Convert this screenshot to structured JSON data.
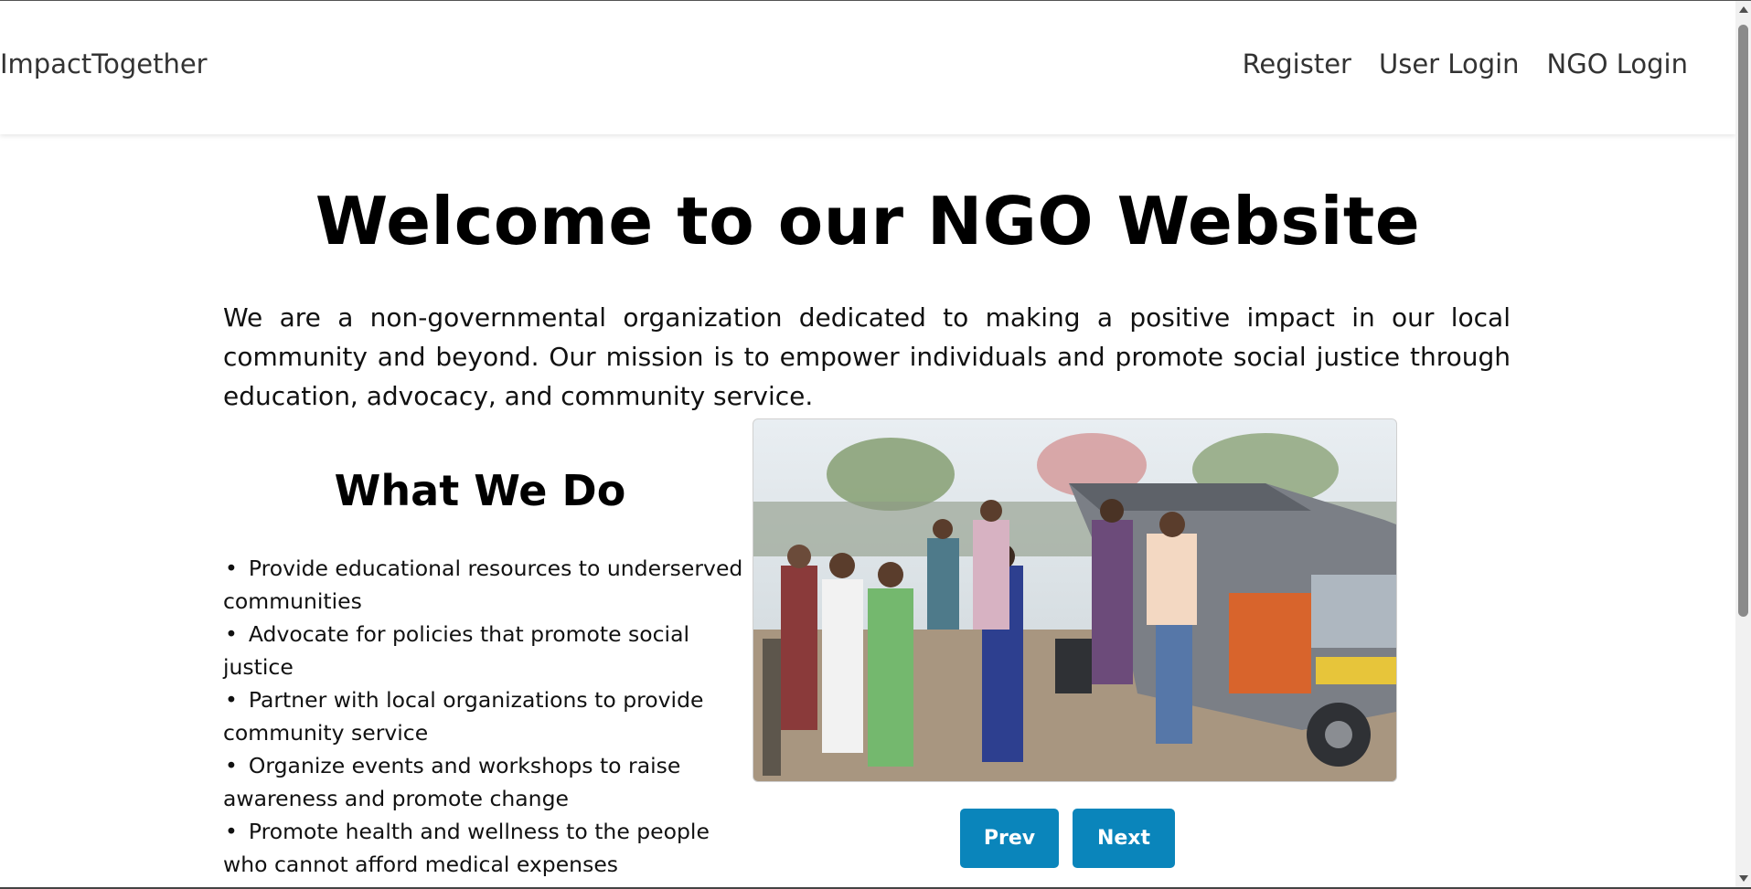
{
  "navbar": {
    "brand": "ImpactTogether",
    "links": [
      "Register",
      "User Login",
      "NGO Login"
    ]
  },
  "main": {
    "title": "Welcome to our NGO Website",
    "intro": "We are a non-governmental organization dedicated to making a positive impact in our local community and beyond. Our mission is to empower individuals and promote social justice through education, advocacy, and community service.",
    "what_we_do": {
      "heading": "What We Do",
      "items": [
        "Provide educational resources to underserved communities",
        "Advocate for policies that promote social justice",
        "Partner with local organizations to provide community service",
        "Organize events and workshops to raise awareness and promote change",
        "Promote health and wellness to the people who cannot afford medical expenses"
      ]
    },
    "carousel": {
      "prev_label": "Prev",
      "next_label": "Next"
    }
  },
  "colors": {
    "button_bg": "#0a85bb",
    "button_text": "#ffffff",
    "navbar_text": "#333333"
  }
}
